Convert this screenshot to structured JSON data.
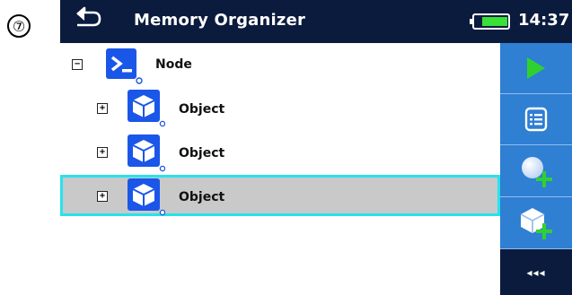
{
  "step_label": "⑦",
  "header": {
    "title": "Memory Organizer",
    "time": "14:37"
  },
  "icons": {
    "back": "back-arrow-icon",
    "battery": "battery-icon",
    "node": "node-terminal-icon",
    "object": "object-cube-icon",
    "start": "play-icon",
    "details": "list-details-icon",
    "add_node": "add-node-icon",
    "add_object": "add-object-icon",
    "collapse": "collapse-panel-icon"
  },
  "tree": {
    "node": {
      "label": "Node",
      "expander": "−"
    },
    "objects": [
      {
        "label": "Object",
        "expander": "+",
        "selected": false
      },
      {
        "label": "Object",
        "expander": "+",
        "selected": false
      },
      {
        "label": "Object",
        "expander": "+",
        "selected": true
      }
    ]
  },
  "side_panel": {
    "collapse_label": "◂◂◂"
  },
  "colors": {
    "header_bg": "#0b1b3d",
    "panel_bg": "#2f7fd3",
    "selection_border": "#27e3ec",
    "selection_bg": "#c9c9c9",
    "icon_blue": "#1a56e8",
    "play_green": "#2fd12f"
  }
}
